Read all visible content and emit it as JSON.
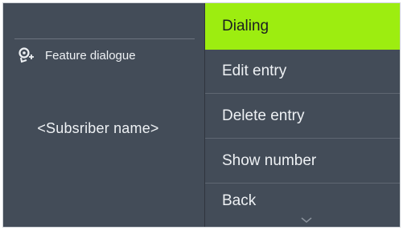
{
  "left_panel": {
    "feature_icon": "phone-settings-icon",
    "feature_label": "Feature dialogue",
    "subscriber_name": "<Subsriber name>"
  },
  "menu": {
    "items": [
      {
        "label": "Dialing",
        "active": true
      },
      {
        "label": "Edit entry",
        "active": false
      },
      {
        "label": "Delete entry",
        "active": false
      },
      {
        "label": "Show number",
        "active": false
      },
      {
        "label": "Back",
        "active": false
      }
    ],
    "scroll_icon": "chevron-down-icon"
  },
  "colors": {
    "background": "#434c58",
    "highlight": "#9ded10",
    "text": "#eef1f4"
  }
}
